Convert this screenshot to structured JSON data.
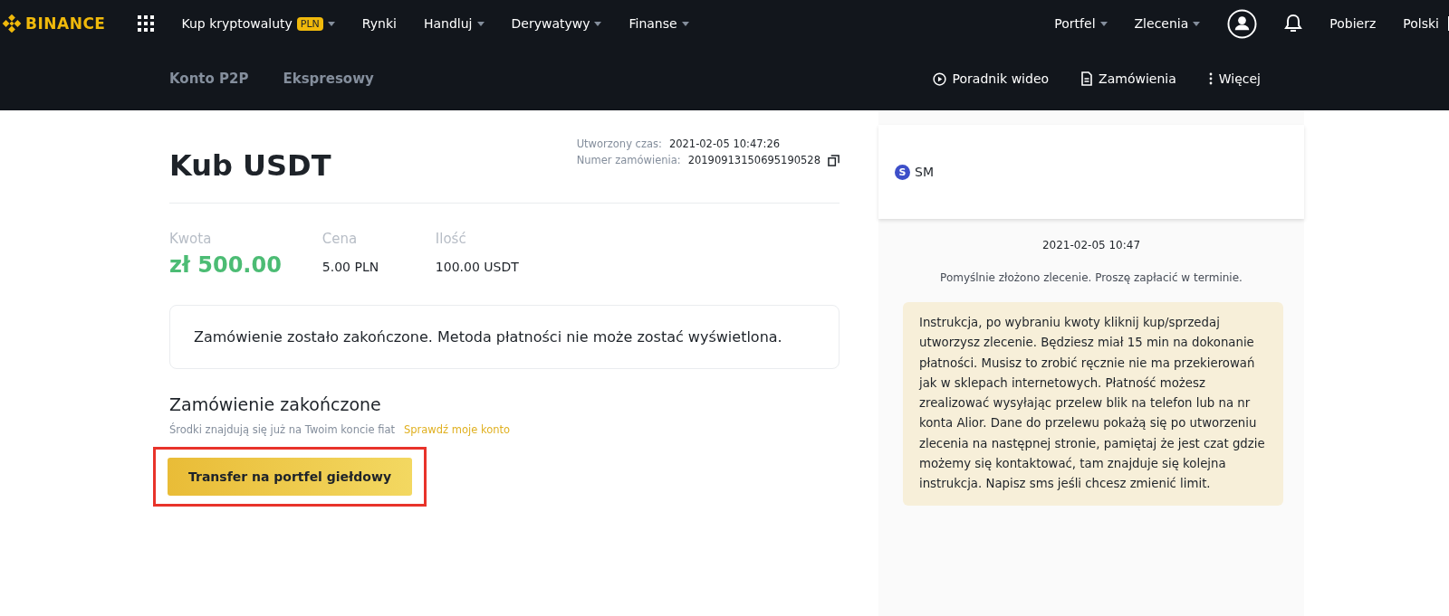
{
  "top_nav": {
    "logo": "BINANCE",
    "items": [
      {
        "label": "Kup kryptowaluty",
        "badge": "PLN",
        "dropdown": true
      },
      {
        "label": "Rynki",
        "dropdown": false
      },
      {
        "label": "Handluj",
        "dropdown": true
      },
      {
        "label": "Derywatywy",
        "dropdown": true
      },
      {
        "label": "Finanse",
        "dropdown": true
      }
    ],
    "right_items": [
      {
        "label": "Portfel",
        "dropdown": true
      },
      {
        "label": "Zlecenia",
        "dropdown": true
      }
    ],
    "links": [
      "Pobierz",
      "Polski"
    ]
  },
  "sub_nav": {
    "tabs": [
      {
        "label": "Konto P2P",
        "selected": false
      },
      {
        "label": "Ekspresowy",
        "selected": false
      }
    ],
    "actions": [
      {
        "label": "Poradnik wideo",
        "kind": "video"
      },
      {
        "label": "Zamówienia",
        "kind": "document"
      },
      {
        "label": "Więcej",
        "kind": "more"
      }
    ]
  },
  "order": {
    "title": "Kub USDT",
    "meta": [
      {
        "label": "Utworzony czas:",
        "value": "2021-02-05 10:47:26",
        "copy": false
      },
      {
        "label": "Numer zamówienia:",
        "value": "20190913150695190528",
        "copy": true
      }
    ],
    "stats": [
      {
        "label": "Kwota",
        "value": "zł 500.00",
        "kind": "amount"
      },
      {
        "label": "Cena",
        "value": "5.00 PLN",
        "kind": "plain"
      },
      {
        "label": "Ilość",
        "value": "100.00 USDT",
        "kind": "plain"
      }
    ],
    "notice": "Zamówienie zostało zakończone. Metoda płatności nie może zostać wyświetlona.",
    "status_title": "Zamówienie zakończone",
    "status_text": "Środki znajdują się już na Twoim koncie fiat",
    "status_link": "Sprawdź moje konto",
    "button": {
      "label": "Transfer na portfel giełdowy",
      "highlighted": true
    }
  },
  "chat": {
    "user": {
      "initial": "S",
      "name": "SM"
    },
    "timestamp": "2021-02-05 10:47",
    "system_message": "Pomyślnie złożono zlecenie. Proszę zapłacić w terminie.",
    "messages": [
      "Instrukcja, po wybraniu kwoty kliknij kup/sprzedaj utworzysz zlecenie. Będziesz miał 15 min na dokonanie płatności. Musisz to zrobić ręcznie nie ma przekierowań jak w sklepach internetowych. Płatność możesz zrealizować wysyłając przelew blik na telefon lub na nr konta Alior. Dane do przelewu pokażą się po utworzeniu zlecenia na następnej stronie, pamiętaj że jest czat gdzie możemy się kontaktować, tam znajduje się kolejna instrukcja. Napisz sms jeśli chcesz zmienić limit."
    ]
  }
}
